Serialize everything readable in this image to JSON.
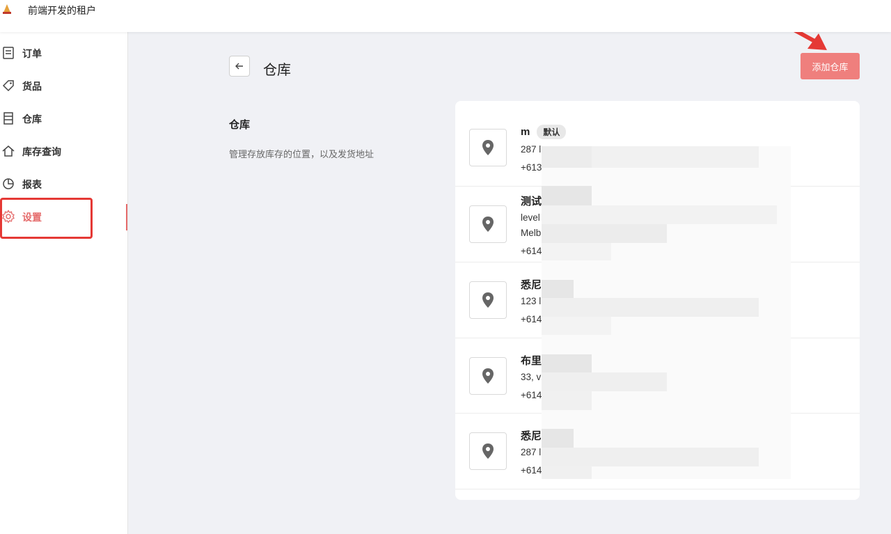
{
  "header": {
    "tenant_name": "前端开发的租户",
    "logo_icon": "app-logo-icon"
  },
  "sidebar": {
    "items": [
      {
        "label": "订单",
        "icon": "order-icon"
      },
      {
        "label": "货品",
        "icon": "tag-icon"
      },
      {
        "label": "仓库",
        "icon": "warehouse-icon"
      },
      {
        "label": "库存查询",
        "icon": "home-icon"
      },
      {
        "label": "报表",
        "icon": "pie-chart-icon"
      },
      {
        "label": "设置",
        "icon": "gear-icon",
        "active": true
      }
    ]
  },
  "page": {
    "title": "仓库",
    "add_button": "添加仓库",
    "section_title": "仓库",
    "section_desc": "管理存放库存的位置，以及发货地址"
  },
  "warehouses": [
    {
      "name": "m",
      "badge": "默认",
      "lines": [
        "287 l",
        "+613"
      ]
    },
    {
      "name": "测试",
      "lines": [
        "level",
        "Melb",
        "+614"
      ]
    },
    {
      "name": "悉尼",
      "lines": [
        "123 l",
        "+614"
      ]
    },
    {
      "name": "布里",
      "lines": [
        "33, v",
        "+614"
      ]
    },
    {
      "name": "悉尼",
      "lines": [
        "287 l",
        "+614"
      ]
    }
  ],
  "colors": {
    "accent": "#e56b6b",
    "add_button": "#ef7f7d",
    "annotation": "#e53935"
  }
}
